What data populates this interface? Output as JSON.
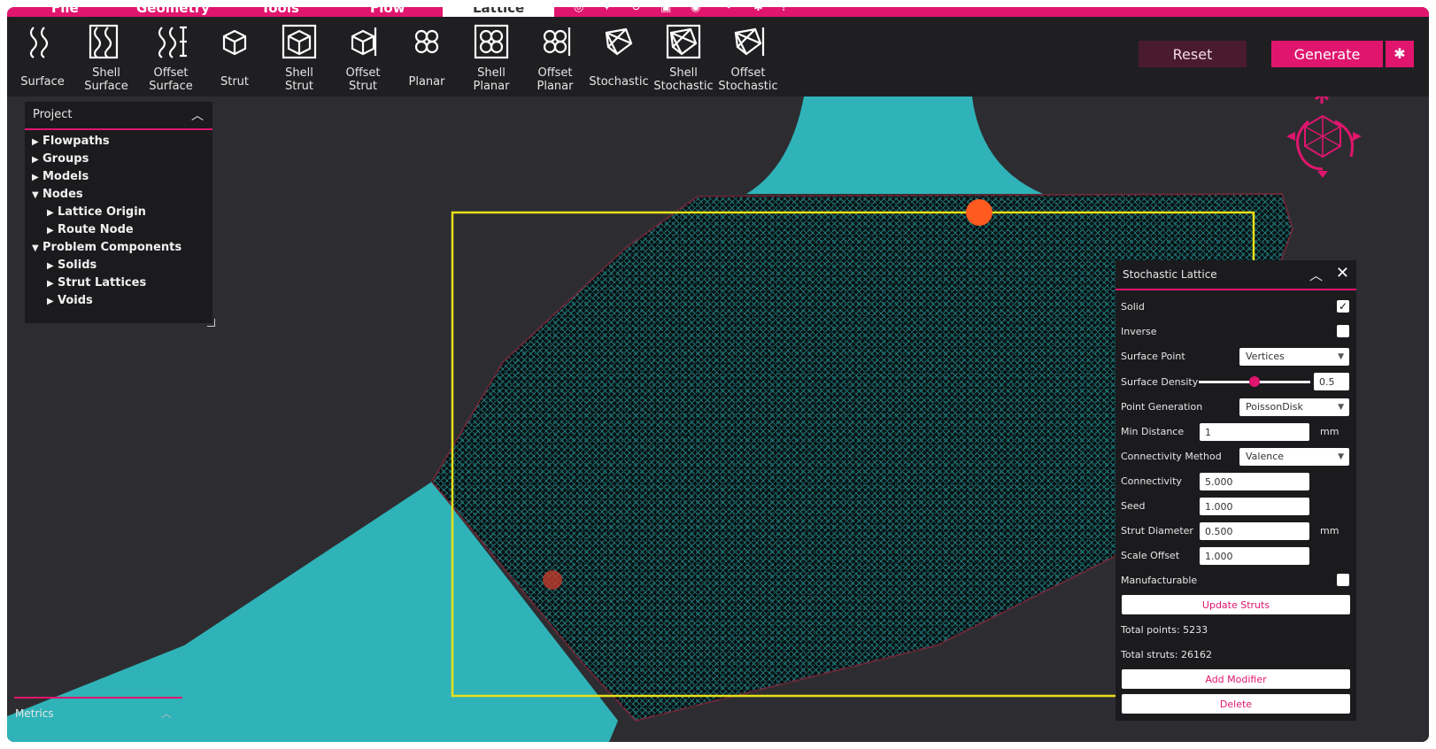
{
  "menu": {
    "tabs": [
      "File",
      "Geometry",
      "Tools",
      "Flow",
      "Lattice"
    ],
    "active_tab": "Lattice"
  },
  "toolbar": {
    "tools": [
      {
        "label1": "Surface",
        "label2": "",
        "icon": "surface-lattice-icon"
      },
      {
        "label1": "Shell",
        "label2": "Surface",
        "icon": "shell-surface-icon"
      },
      {
        "label1": "Offset",
        "label2": "Surface",
        "icon": "offset-surface-icon"
      },
      {
        "label1": "Strut",
        "label2": "",
        "icon": "strut-lattice-icon"
      },
      {
        "label1": "Shell",
        "label2": "Strut",
        "icon": "shell-strut-icon"
      },
      {
        "label1": "Offset",
        "label2": "Strut",
        "icon": "offset-strut-icon"
      },
      {
        "label1": "Planar",
        "label2": "",
        "icon": "planar-lattice-icon"
      },
      {
        "label1": "Shell",
        "label2": "Planar",
        "icon": "shell-planar-icon"
      },
      {
        "label1": "Offset",
        "label2": "Planar",
        "icon": "offset-planar-icon"
      },
      {
        "label1": "Stochastic",
        "label2": "",
        "icon": "stochastic-lattice-icon"
      },
      {
        "label1": "Shell",
        "label2": "Stochastic",
        "icon": "shell-stochastic-icon"
      },
      {
        "label1": "Offset",
        "label2": "Stochastic",
        "icon": "offset-stochastic-icon"
      }
    ],
    "reset_label": "Reset",
    "generate_label": "Generate"
  },
  "colors": {
    "accent": "#e0156e",
    "model": "#2fb3b8",
    "bounding_box": "#e8e01a",
    "marker": "#ff5a1f"
  },
  "project": {
    "title": "Project",
    "items": [
      {
        "label": "Flowpaths",
        "level": 0,
        "expanded": false
      },
      {
        "label": "Groups",
        "level": 0,
        "expanded": false
      },
      {
        "label": "Models",
        "level": 0,
        "expanded": false
      },
      {
        "label": "Nodes",
        "level": 0,
        "expanded": true
      },
      {
        "label": "Lattice Origin",
        "level": 1,
        "expanded": false
      },
      {
        "label": "Route Node",
        "level": 1,
        "expanded": false
      },
      {
        "label": "Problem Components",
        "level": 0,
        "expanded": true
      },
      {
        "label": "Solids",
        "level": 1,
        "expanded": false
      },
      {
        "label": "Strut Lattices",
        "level": 1,
        "expanded": false
      },
      {
        "label": "Voids",
        "level": 1,
        "expanded": false
      }
    ]
  },
  "metrics": {
    "label": "Metrics"
  },
  "lattice": {
    "title": "Stochastic Lattice",
    "solid_label": "Solid",
    "solid_checked": true,
    "inverse_label": "Inverse",
    "inverse_checked": false,
    "surface_point_label": "Surface Point",
    "surface_point_value": "Vertices",
    "surface_density_label": "Surface Density",
    "surface_density_value": "0.5",
    "surface_density_fraction": 0.5,
    "point_generation_label": "Point Generation",
    "point_generation_value": "PoissonDisk",
    "min_distance_label": "Min Distance",
    "min_distance_value": "1",
    "min_distance_unit": "mm",
    "connectivity_method_label": "Connectivity Method",
    "connectivity_method_value": "Valence",
    "connectivity_label": "Connectivity",
    "connectivity_value": "5.000",
    "seed_label": "Seed",
    "seed_value": "1.000",
    "strut_diameter_label": "Strut Diameter",
    "strut_diameter_value": "0.500",
    "strut_diameter_unit": "mm",
    "scale_offset_label": "Scale Offset",
    "scale_offset_value": "1.000",
    "manufacturable_label": "Manufacturable",
    "manufacturable_checked": false,
    "update_struts_label": "Update Struts",
    "total_points_text": "Total points: 5233",
    "total_struts_text": "Total struts: 26162",
    "add_modifier_label": "Add Modifier",
    "delete_label": "Delete"
  }
}
